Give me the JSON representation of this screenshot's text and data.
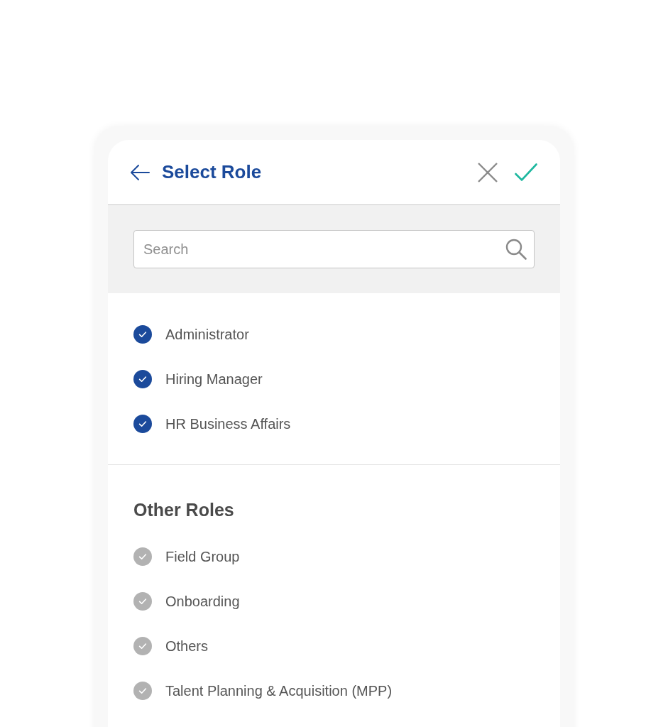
{
  "header": {
    "title": "Select Role"
  },
  "search": {
    "placeholder": "Search"
  },
  "selected_roles": {
    "items": [
      {
        "label": "Administrator",
        "selected": true
      },
      {
        "label": "Hiring Manager",
        "selected": true
      },
      {
        "label": "HR Business Affairs",
        "selected": true
      }
    ]
  },
  "other_roles": {
    "heading": "Other Roles",
    "items": [
      {
        "label": "Field Group",
        "selected": false
      },
      {
        "label": "Onboarding",
        "selected": false
      },
      {
        "label": "Others",
        "selected": false
      },
      {
        "label": "Talent Planning & Acquisition (MPP)",
        "selected": false
      }
    ]
  }
}
